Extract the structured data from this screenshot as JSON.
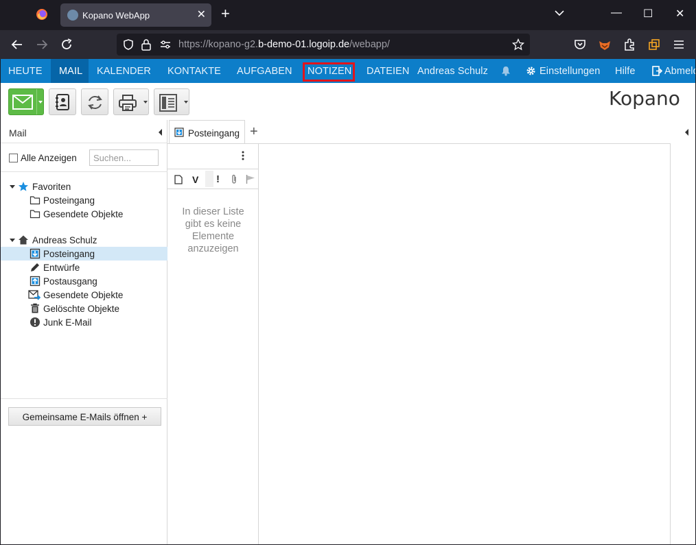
{
  "browser": {
    "tab_title": "Kopano WebApp",
    "url_prefix": "https://kopano-g2.",
    "url_host": "b-demo-01.logoip.de",
    "url_suffix": "/webapp/"
  },
  "topnav": {
    "items": [
      "HEUTE",
      "MAIL",
      "KALENDER",
      "KONTAKTE",
      "AUFGABEN",
      "NOTIZEN",
      "DATEIEN"
    ],
    "active": "MAIL",
    "highlighted": "NOTIZEN",
    "user": "Andreas Schulz",
    "settings": "Einstellungen",
    "help": "Hilfe",
    "logout": "Abmelden"
  },
  "logo": "Kopano",
  "leftpanel": {
    "title": "Mail",
    "show_all": "Alle Anzeigen",
    "search_placeholder": "Suchen...",
    "favorites_label": "Favoriten",
    "favorites": [
      "Posteingang",
      "Gesendete Objekte"
    ],
    "store_label": "Andreas Schulz",
    "folders": [
      "Posteingang",
      "Entwürfe",
      "Postausgang",
      "Gesendete Objekte",
      "Gelöschte Objekte",
      "Junk E-Mail"
    ],
    "selected_folder": "Posteingang",
    "shared_button": "Gemeinsame E-Mails öffnen +"
  },
  "main": {
    "tab_label": "Posteingang",
    "list_header_letter": "V",
    "empty_message": "In dieser Liste gibt es keine Elemente anzuzeigen"
  },
  "colors": {
    "nav_bg": "#0d7ec9",
    "nav_active": "#0665a8",
    "highlight_box": "#e3141b",
    "selected_row": "#d3e8f7",
    "compose_green": "#5dbb46"
  }
}
